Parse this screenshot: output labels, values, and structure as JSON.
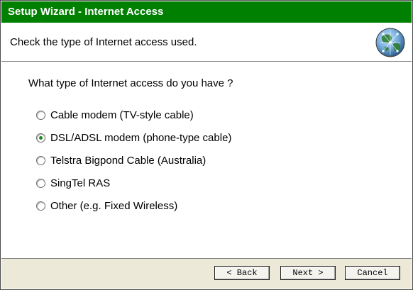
{
  "window": {
    "title": "Setup Wizard - Internet Access"
  },
  "header": {
    "text": "Check the type of Internet access used.",
    "icon": "globe-icon"
  },
  "main": {
    "question": "What type of Internet access do you have ?",
    "options": [
      {
        "label": "Cable modem (TV-style cable)",
        "selected": false
      },
      {
        "label": "DSL/ADSL modem (phone-type cable)",
        "selected": true
      },
      {
        "label": "Telstra Bigpond Cable (Australia)",
        "selected": false
      },
      {
        "label": "SingTel RAS",
        "selected": false
      },
      {
        "label": "Other (e.g. Fixed Wireless)",
        "selected": false
      }
    ]
  },
  "footer": {
    "back_label": "< Back",
    "next_label": "Next >",
    "cancel_label": "Cancel"
  },
  "colors": {
    "titlebar": "#008000",
    "selected_radio": "#1e8a1e",
    "footer_bg": "#ece9d8"
  }
}
